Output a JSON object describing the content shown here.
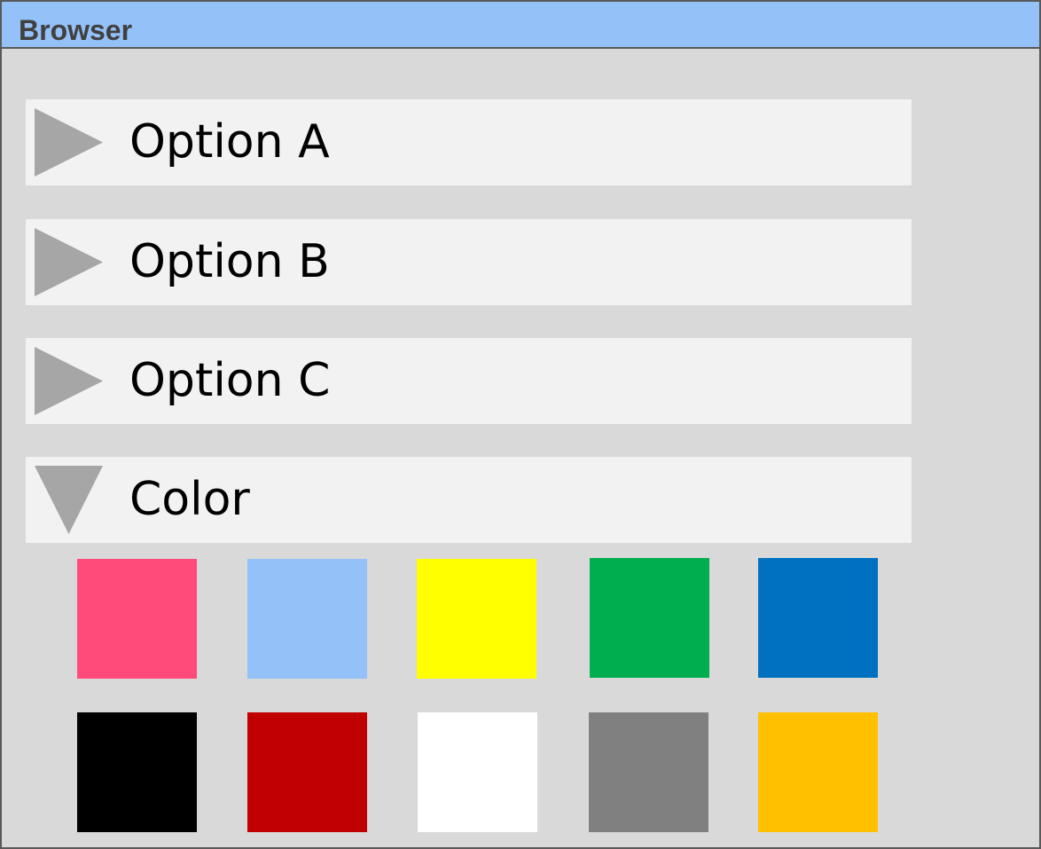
{
  "window": {
    "title": "Browser"
  },
  "options": [
    {
      "label": "Option A",
      "state": "collapsed",
      "icon": "triangle-right-icon"
    },
    {
      "label": "Option B",
      "state": "collapsed",
      "icon": "triangle-right-icon"
    },
    {
      "label": "Option C",
      "state": "collapsed",
      "icon": "triangle-right-icon"
    },
    {
      "label": "Color",
      "state": "expanded",
      "icon": "triangle-down-icon"
    }
  ],
  "colors": {
    "titlebar": "#94c1f8",
    "background": "#d9d9d9",
    "row_background": "#f2f2f2",
    "arrow": "#a6a6a6",
    "swatches": [
      "#ff4b7a",
      "#94c1f8",
      "#ffff00",
      "#00ad4f",
      "#0070c0",
      "#000000",
      "#c00000",
      "#ffffff",
      "#808080",
      "#ffc000"
    ]
  }
}
